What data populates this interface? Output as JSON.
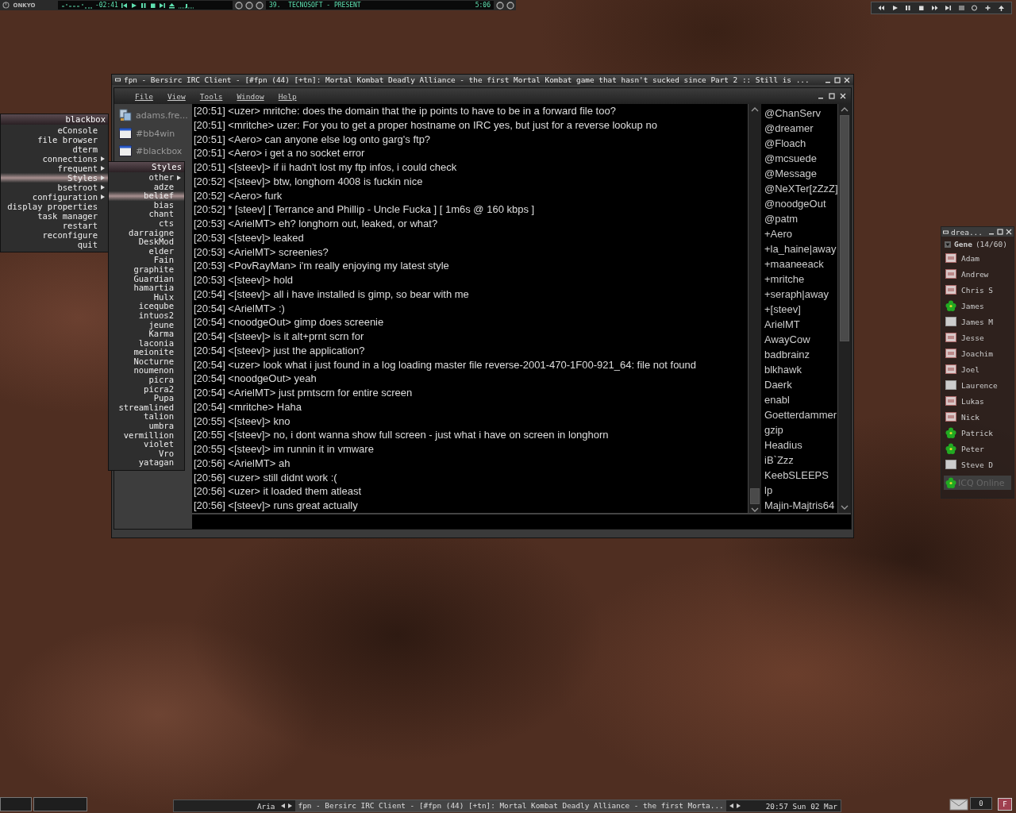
{
  "media_player": {
    "brand": "ONKYO",
    "counter": "-02:41",
    "track": "39.  TECNOSOFT - PRESENT",
    "track_time": "5:06"
  },
  "irc_window": {
    "title": "fpn - Bersirc IRC Client - [#fpn (44) [+tn]: Mortal Kombat Deadly Alliance - the first Mortal Kombat game that hasn't sucked since Part 2 :: Still is ...",
    "menu": [
      "File",
      "View",
      "Tools",
      "Window",
      "Help"
    ],
    "channels": [
      {
        "label": "adams.fre...",
        "kind": "server"
      },
      {
        "label": "#bb4win",
        "kind": "channel"
      },
      {
        "label": "#blackbox",
        "kind": "channel"
      }
    ],
    "messages": [
      "[20:51] <uzer> mritche: does the domain that the ip points to have to be in a forward file too?",
      "[20:51] <mritche> uzer: For you to get a proper hostname on IRC yes, but just for a reverse lookup no",
      "[20:51] <Aero> can anyone else log onto garg's ftp?",
      "[20:51] <Aero> i get a no socket error",
      "[20:51] <[steev]> if ii hadn't lost my ftp infos, i could check",
      "[20:52] <[steev]> btw, longhorn 4008 is fuckin nice",
      "[20:52] <Aero> furk",
      "[20:52] * [steev] [ Terrance and Phillip - Uncle Fucka ] [ 1m6s @ 160 kbps ]",
      "[20:53] <ArielMT> eh?  longhorn out, leaked, or what?",
      "[20:53] <[steev]> leaked",
      "[20:53] <ArielMT> screenies?",
      "[20:53] <PovRayMan> i'm really enjoying my latest style",
      "[20:53] <[steev]> hold",
      "[20:54] <[steev]> all i have installed is gimp, so bear with me",
      "[20:54] <ArielMT> :)",
      "[20:54] <noodgeOut> gimp does screenie",
      "[20:54] <[steev]> is it alt+prnt scrn for",
      "[20:54] <[steev]> just the application?",
      "[20:54] <uzer> look what i just found in a log loading master file reverse-2001-470-1F00-921_64: file not found",
      "[20:54] <noodgeOut> yeah",
      "[20:54] <ArielMT> just prntscrn for entire screen",
      "[20:54] <mritche> Haha",
      "[20:55] <[steev]> kno",
      "[20:55] <[steev]> no, i dont wanna show full screen - just what i have on screen in longhorn",
      "[20:55] <[steev]> im runnin it in vmware",
      "[20:56] <ArielMT> ah",
      "[20:56] <uzer> still didnt work :(",
      "[20:56] <uzer> it loaded them atleast",
      "[20:56] <[steev]> runs great actually"
    ],
    "users": [
      "@ChanServ",
      "@dreamer",
      "@Floach",
      "@mcsuede",
      "@Message",
      "@NeXTer[zZzZ]",
      "@noodgeOut",
      "@patm",
      "+Aero",
      "+la_haine|away",
      "+maaneeack",
      "+mritche",
      "+seraph|away",
      "+[steev]",
      "ArielMT",
      "AwayCow",
      "badbrainz",
      "blkhawk",
      "Daerk",
      "enabl",
      "Goetterdammer",
      "gzip",
      "Headius",
      "iB`Zzz",
      "KeebSLEEPS",
      "lp",
      "Majin-Majtris64"
    ]
  },
  "blackbox_menu": {
    "title": "blackbox",
    "items": [
      {
        "label": "eConsole",
        "submenu": false,
        "selected": false
      },
      {
        "label": "file browser",
        "submenu": false,
        "selected": false
      },
      {
        "label": "dterm",
        "submenu": false,
        "selected": false
      },
      {
        "label": "connections",
        "submenu": true,
        "selected": false
      },
      {
        "label": "frequent",
        "submenu": true,
        "selected": false
      },
      {
        "label": "Styles",
        "submenu": true,
        "selected": true
      },
      {
        "label": "bsetroot",
        "submenu": true,
        "selected": false
      },
      {
        "label": "configuration",
        "submenu": true,
        "selected": false
      },
      {
        "label": "display properties",
        "submenu": false,
        "selected": false
      },
      {
        "label": "task manager",
        "submenu": false,
        "selected": false
      },
      {
        "label": "restart",
        "submenu": false,
        "selected": false
      },
      {
        "label": "reconfigure",
        "submenu": false,
        "selected": false
      },
      {
        "label": "quit",
        "submenu": false,
        "selected": false
      }
    ]
  },
  "styles_menu": {
    "title": "Styles",
    "items": [
      {
        "label": "other",
        "submenu": true,
        "selected": false
      },
      {
        "label": "adze",
        "submenu": false,
        "selected": false
      },
      {
        "label": "belief",
        "submenu": false,
        "selected": true
      },
      {
        "label": "bias",
        "submenu": false,
        "selected": false
      },
      {
        "label": "chant",
        "submenu": false,
        "selected": false
      },
      {
        "label": "cts",
        "submenu": false,
        "selected": false
      },
      {
        "label": "darraigne",
        "submenu": false,
        "selected": false
      },
      {
        "label": "DeskMod",
        "submenu": false,
        "selected": false
      },
      {
        "label": "elder",
        "submenu": false,
        "selected": false
      },
      {
        "label": "Fain",
        "submenu": false,
        "selected": false
      },
      {
        "label": "graphite",
        "submenu": false,
        "selected": false
      },
      {
        "label": "Guardian",
        "submenu": false,
        "selected": false
      },
      {
        "label": "hamartia",
        "submenu": false,
        "selected": false
      },
      {
        "label": "Hulx",
        "submenu": false,
        "selected": false
      },
      {
        "label": "iceqube",
        "submenu": false,
        "selected": false
      },
      {
        "label": "intuos2",
        "submenu": false,
        "selected": false
      },
      {
        "label": "jeune",
        "submenu": false,
        "selected": false
      },
      {
        "label": "Karma",
        "submenu": false,
        "selected": false
      },
      {
        "label": "laconia",
        "submenu": false,
        "selected": false
      },
      {
        "label": "meionite",
        "submenu": false,
        "selected": false
      },
      {
        "label": "Nocturne",
        "submenu": false,
        "selected": false
      },
      {
        "label": "noumenon",
        "submenu": false,
        "selected": false
      },
      {
        "label": "picra",
        "submenu": false,
        "selected": false
      },
      {
        "label": "picra2",
        "submenu": false,
        "selected": false
      },
      {
        "label": "Pupa",
        "submenu": false,
        "selected": false
      },
      {
        "label": "streamlined",
        "submenu": false,
        "selected": false
      },
      {
        "label": "talion",
        "submenu": false,
        "selected": false
      },
      {
        "label": "umbra",
        "submenu": false,
        "selected": false
      },
      {
        "label": "vermillion",
        "submenu": false,
        "selected": false
      },
      {
        "label": "violet",
        "submenu": false,
        "selected": false
      },
      {
        "label": "Vro",
        "submenu": false,
        "selected": false
      },
      {
        "label": "yatagan",
        "submenu": false,
        "selected": false
      }
    ]
  },
  "icq_window": {
    "title": "drea...",
    "group": "Gene",
    "group_count": "(14/60)",
    "contacts": [
      {
        "name": "Adam",
        "kind": "na"
      },
      {
        "name": "Andrew",
        "kind": "na"
      },
      {
        "name": "Chris S",
        "kind": "na"
      },
      {
        "name": "James",
        "kind": "online"
      },
      {
        "name": "James M",
        "kind": "offline"
      },
      {
        "name": "Jesse",
        "kind": "na"
      },
      {
        "name": "Joachim",
        "kind": "na"
      },
      {
        "name": "Joel",
        "kind": "na"
      },
      {
        "name": "Laurence",
        "kind": "offline"
      },
      {
        "name": "Lukas",
        "kind": "na"
      },
      {
        "name": "Nick",
        "kind": "na"
      },
      {
        "name": "Patrick",
        "kind": "online"
      },
      {
        "name": "Peter",
        "kind": "online"
      },
      {
        "name": "Steve D",
        "kind": "offline"
      }
    ],
    "status_button": "ICQ Online"
  },
  "taskbar": {
    "workspace": "Aria",
    "task": "fpn - Bersirc IRC Client - [#fpn (44) [+tn]: Mortal Kombat Deadly Alliance - the first Morta...",
    "clock": "20:57 Sun 02 Mar",
    "mail_count": "0",
    "button": "F"
  }
}
